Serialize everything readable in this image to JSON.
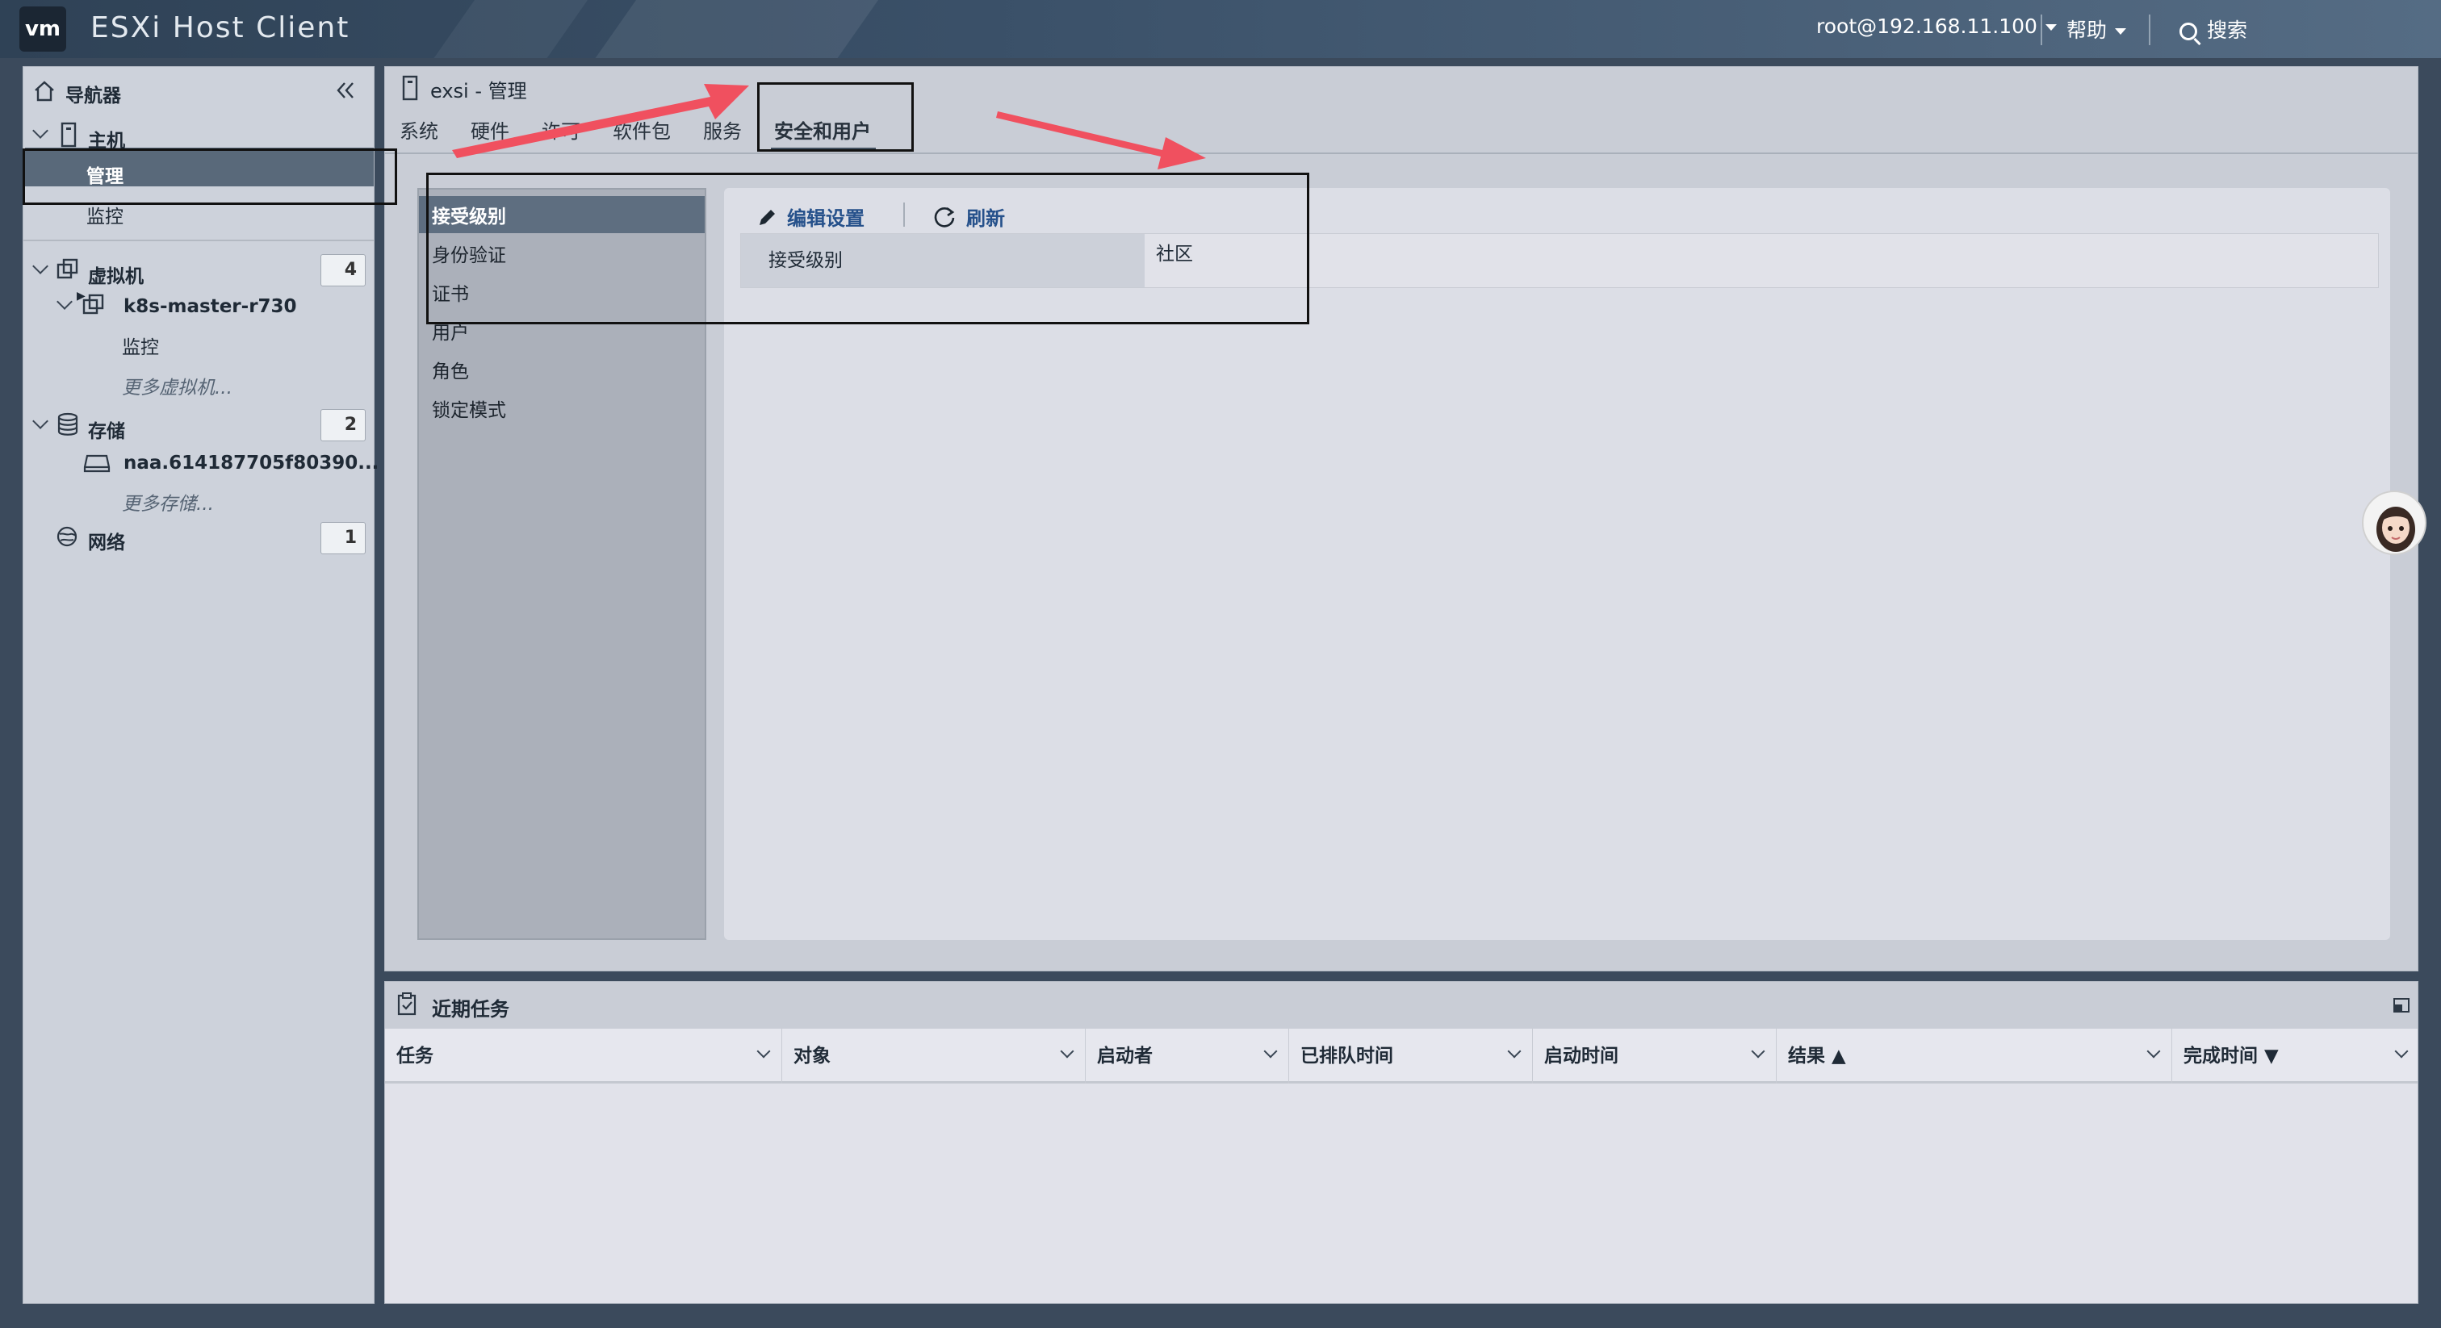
{
  "app": {
    "logo": "vm",
    "title": "ESXi Host Client"
  },
  "topbar": {
    "user": "root@192.168.11.100",
    "help": "帮助",
    "search": "搜索"
  },
  "navigator": {
    "title": "导航器",
    "host": {
      "label": "主机",
      "children": [
        "管理",
        "监控"
      ]
    },
    "vms": {
      "label": "虚拟机",
      "count": "4",
      "vm": {
        "label": "k8s-master-r730",
        "children": [
          "监控"
        ]
      },
      "more": "更多虚拟机..."
    },
    "storage": {
      "label": "存储",
      "count": "2",
      "item": "naa.614187705f80390...",
      "more": "更多存储..."
    },
    "network": {
      "label": "网络",
      "count": "1"
    }
  },
  "main": {
    "title": "exsi - 管理",
    "tabs": [
      "系统",
      "硬件",
      "许可",
      "软件包",
      "服务",
      "安全和用户"
    ],
    "active_tab": "安全和用户",
    "subnav": [
      "接受级别",
      "身份验证",
      "证书",
      "用户",
      "角色",
      "锁定模式"
    ],
    "active_subnav": "接受级别",
    "actions": {
      "edit": "编辑设置",
      "refresh": "刷新"
    },
    "property": {
      "key": "接受级别",
      "value": "社区"
    }
  },
  "tasks": {
    "title": "近期任务",
    "columns": [
      "任务",
      "对象",
      "启动者",
      "已排队时间",
      "启动时间",
      "结果 ▲",
      "完成时间 ▼"
    ],
    "rows": []
  },
  "colors": {
    "topbar": "#2f4256",
    "selection": "#59697a",
    "link": "#26518b",
    "annotation_arrow": "#f0505f"
  },
  "icons": [
    "home-icon",
    "collapse-icon",
    "host-icon",
    "vm-icon",
    "storage-icon",
    "network-icon",
    "edit-icon",
    "refresh-icon",
    "tasks-icon",
    "maximize-icon"
  ]
}
